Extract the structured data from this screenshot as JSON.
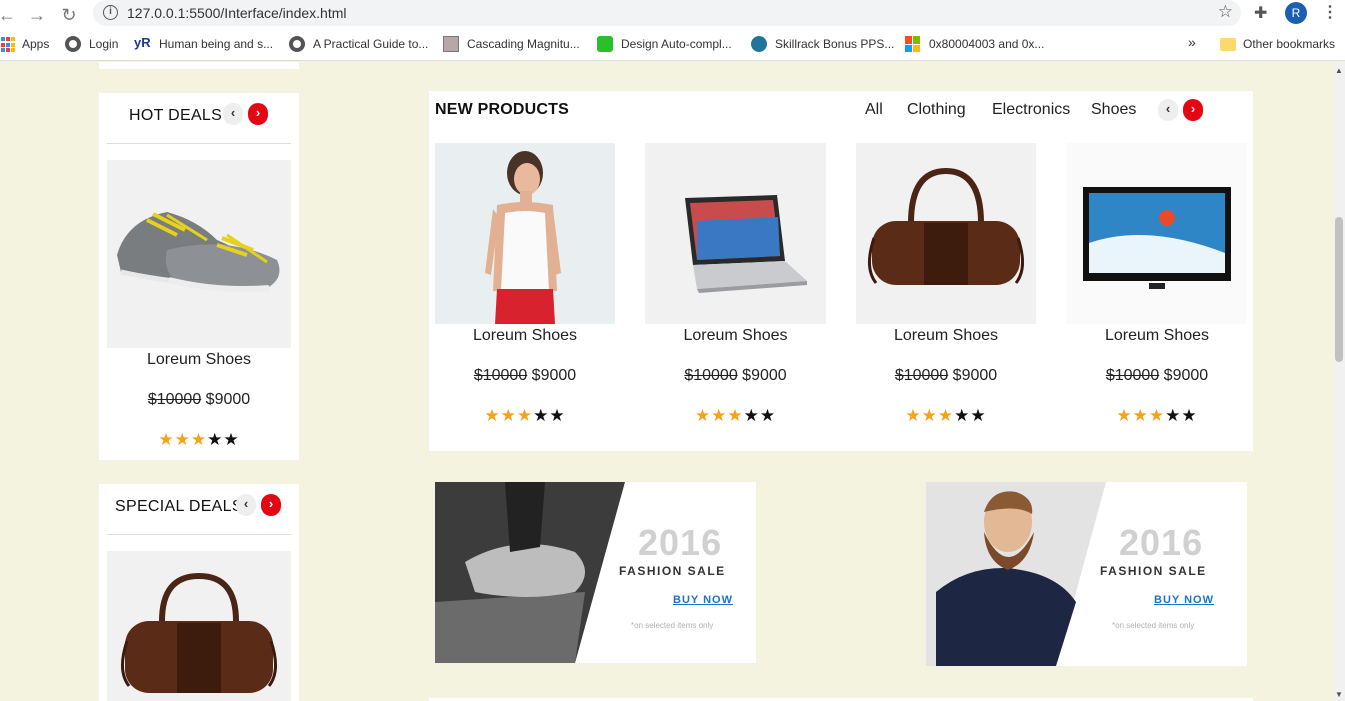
{
  "browser": {
    "url": "127.0.0.1:5500/Interface/index.html",
    "bookmarks": [
      {
        "label": "Apps",
        "icon": "apps-grid-icon"
      },
      {
        "label": "Login",
        "icon": "globe-icon"
      },
      {
        "label": "Human being and s...",
        "icon": "yr-logo-icon"
      },
      {
        "label": "A Practical Guide to...",
        "icon": "globe-icon"
      },
      {
        "label": "Cascading Magnitu...",
        "icon": "page-thumbnail-icon"
      },
      {
        "label": "Design Auto-compl...",
        "icon": "green-clock-icon"
      },
      {
        "label": "Skillrack Bonus PPS...",
        "icon": "wordpress-icon"
      },
      {
        "label": "0x80004003 and 0x...",
        "icon": "windows-logo-icon"
      }
    ],
    "overflow_label": "»",
    "other_bookmarks": "Other bookmarks",
    "profile_initial": "R"
  },
  "hot_deals": {
    "title": "HOT DEALS",
    "product": {
      "name": "Loreum Shoes",
      "old_price": "$10000",
      "price": "$9000",
      "rating": 3,
      "rating_max": 5
    }
  },
  "special_deals": {
    "title": "SPECIAL DEALS"
  },
  "new_products": {
    "title": "NEW PRODUCTS",
    "tabs": [
      "All",
      "Clothing",
      "Electronics",
      "Shoes"
    ],
    "items": [
      {
        "name": "Loreum Shoes",
        "old_price": "$10000",
        "price": "$9000",
        "rating": 3,
        "rating_max": 5,
        "image": "woman-white-top"
      },
      {
        "name": "Loreum Shoes",
        "old_price": "$10000",
        "price": "$9000",
        "rating": 3,
        "rating_max": 5,
        "image": "laptop"
      },
      {
        "name": "Loreum Shoes",
        "old_price": "$10000",
        "price": "$9000",
        "rating": 3,
        "rating_max": 5,
        "image": "leather-bag"
      },
      {
        "name": "Loreum Shoes",
        "old_price": "$10000",
        "price": "$9000",
        "rating": 3,
        "rating_max": 5,
        "image": "tv"
      }
    ]
  },
  "banners": [
    {
      "year": "2016",
      "sale": "FASHION SALE",
      "cta": "BUY NOW",
      "note": "*on selected items only",
      "image": "sneaker-bw"
    },
    {
      "year": "2016",
      "sale": "FASHION SALE",
      "cta": "BUY NOW",
      "note": "*on selected items only",
      "image": "bearded-man"
    }
  ],
  "colors": {
    "page_bg": "#f3f3df",
    "accent_red": "#e30613",
    "star_on": "#f7a21b",
    "link_blue": "#1e73c8"
  }
}
